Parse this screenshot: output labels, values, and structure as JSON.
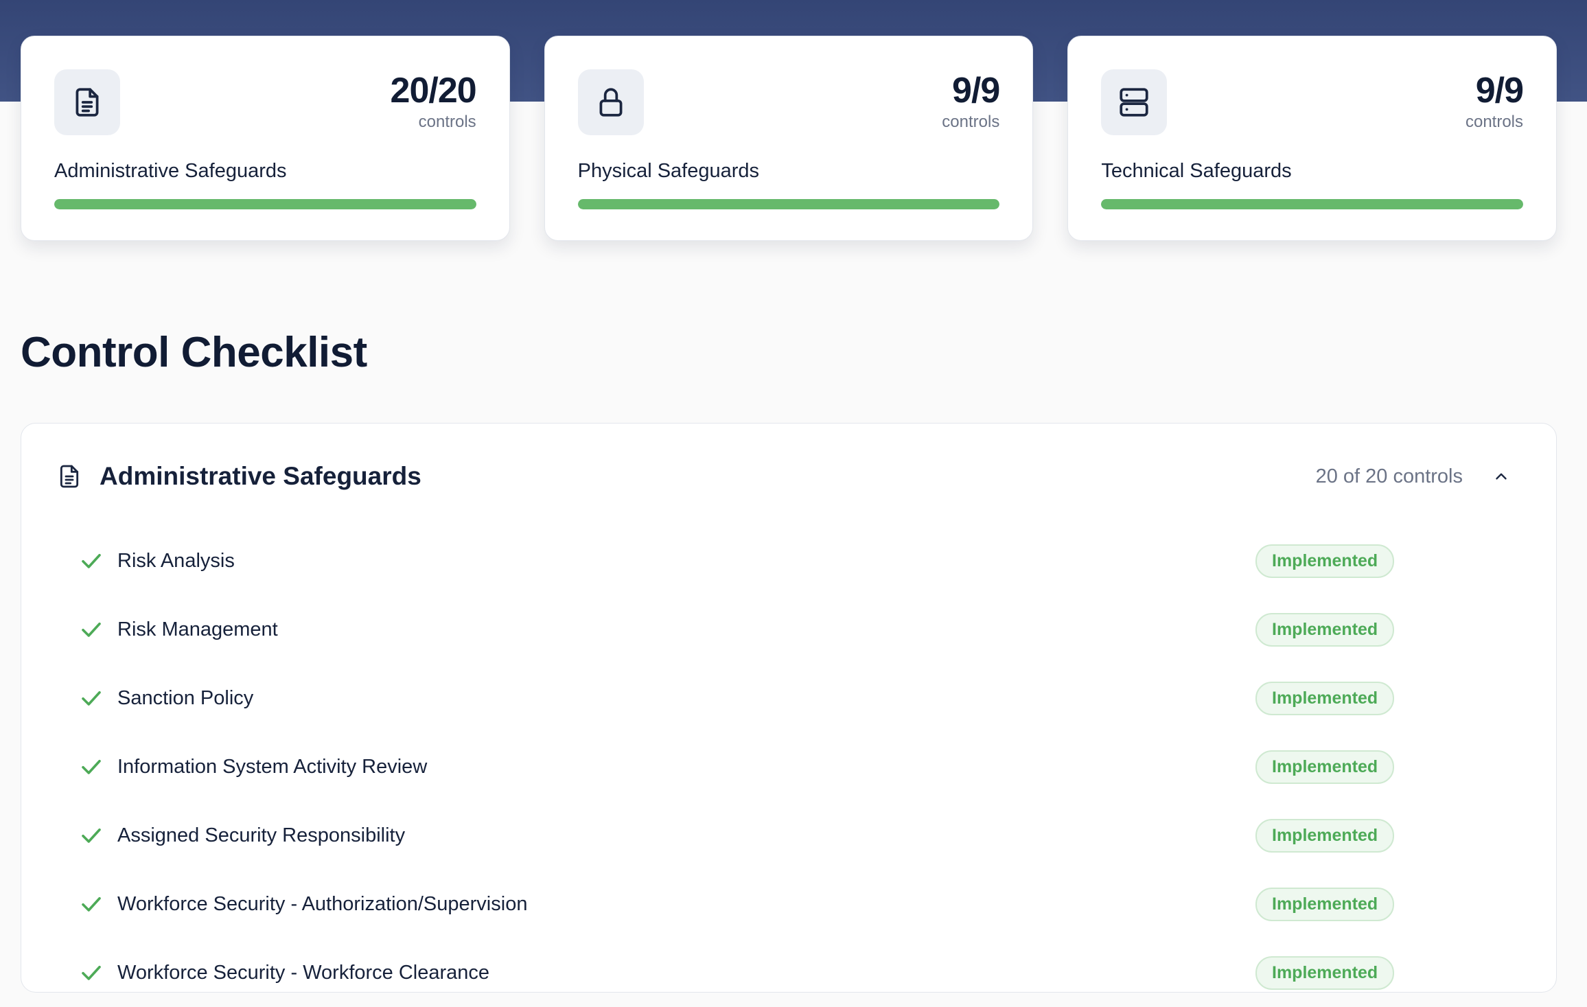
{
  "summary_cards": [
    {
      "icon": "document-icon",
      "count": "20/20",
      "count_sub": "controls",
      "title": "Administrative Safeguards",
      "progress": 1.0
    },
    {
      "icon": "lock-icon",
      "count": "9/9",
      "count_sub": "controls",
      "title": "Physical Safeguards",
      "progress": 1.0
    },
    {
      "icon": "server-icon",
      "count": "9/9",
      "count_sub": "controls",
      "title": "Technical Safeguards",
      "progress": 1.0
    }
  ],
  "checklist": {
    "title": "Control Checklist",
    "section": {
      "icon": "document-icon",
      "title": "Administrative Safeguards",
      "count": "20 of 20 controls",
      "expanded": true,
      "items": [
        {
          "label": "Risk Analysis",
          "status": "Implemented"
        },
        {
          "label": "Risk Management",
          "status": "Implemented"
        },
        {
          "label": "Sanction Policy",
          "status": "Implemented"
        },
        {
          "label": "Information System Activity Review",
          "status": "Implemented"
        },
        {
          "label": "Assigned Security Responsibility",
          "status": "Implemented"
        },
        {
          "label": "Workforce Security - Authorization/Supervision",
          "status": "Implemented"
        },
        {
          "label": "Workforce Security - Workforce Clearance",
          "status": "Implemented"
        }
      ]
    }
  },
  "colors": {
    "banner": "#3a4b7c",
    "progress": "#66b96b",
    "status_green": "#4daa57"
  }
}
